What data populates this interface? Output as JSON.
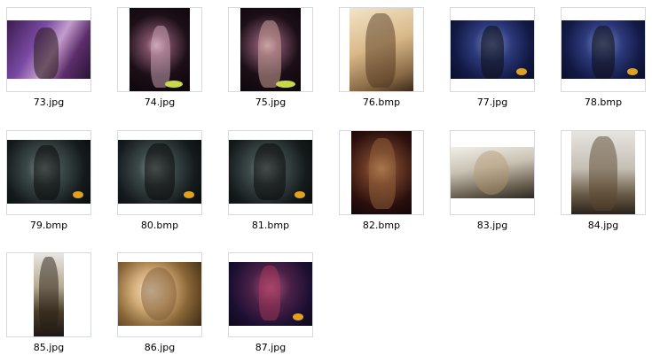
{
  "files": [
    {
      "name": "73.jpg"
    },
    {
      "name": "74.jpg"
    },
    {
      "name": "75.jpg"
    },
    {
      "name": "76.bmp"
    },
    {
      "name": "77.jpg"
    },
    {
      "name": "78.bmp"
    },
    {
      "name": "79.bmp"
    },
    {
      "name": "80.bmp"
    },
    {
      "name": "81.bmp"
    },
    {
      "name": "82.bmp"
    },
    {
      "name": "83.jpg"
    },
    {
      "name": "84.jpg"
    },
    {
      "name": "85.jpg"
    },
    {
      "name": "86.jpg"
    },
    {
      "name": "87.jpg"
    }
  ],
  "colors": {
    "thumbnail_border": "#d6d9e0",
    "caption_text": "#000000",
    "background": "#ffffff"
  }
}
